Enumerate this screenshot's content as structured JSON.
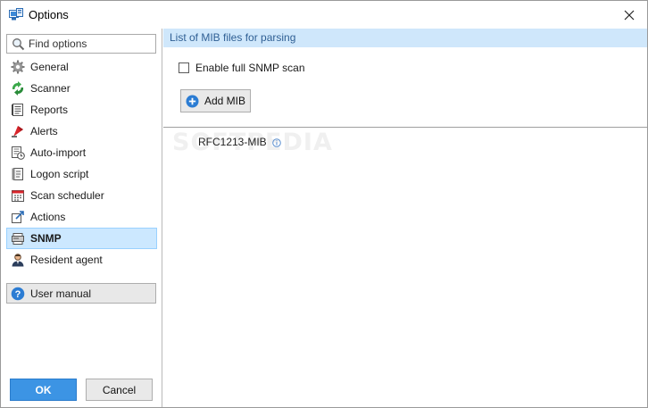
{
  "window": {
    "title": "Options",
    "close_glyph": "✕"
  },
  "sidebar": {
    "search_placeholder": "Find options",
    "items": [
      {
        "label": "General",
        "icon": "gear-icon"
      },
      {
        "label": "Scanner",
        "icon": "scanner-icon"
      },
      {
        "label": "Reports",
        "icon": "report-icon"
      },
      {
        "label": "Alerts",
        "icon": "alert-icon"
      },
      {
        "label": "Auto-import",
        "icon": "auto-import-icon"
      },
      {
        "label": "Logon script",
        "icon": "script-icon"
      },
      {
        "label": "Scan scheduler",
        "icon": "calendar-icon"
      },
      {
        "label": "Actions",
        "icon": "actions-icon"
      },
      {
        "label": "SNMP",
        "icon": "snmp-icon",
        "active": true
      },
      {
        "label": "Resident agent",
        "icon": "agent-icon"
      }
    ],
    "manual_label": "User manual",
    "ok_label": "OK",
    "cancel_label": "Cancel"
  },
  "main": {
    "header": "List of MIB files for parsing",
    "checkbox_label": "Enable full SNMP scan",
    "checkbox_checked": false,
    "add_button_label": "Add MIB",
    "mib_files": [
      "RFC1213-MIB"
    ]
  },
  "watermark": "SOFTPEDIA",
  "colors": {
    "accent": "#3c94e4",
    "header_bg": "#cfe7fb",
    "selected_bg": "#cce8ff"
  }
}
